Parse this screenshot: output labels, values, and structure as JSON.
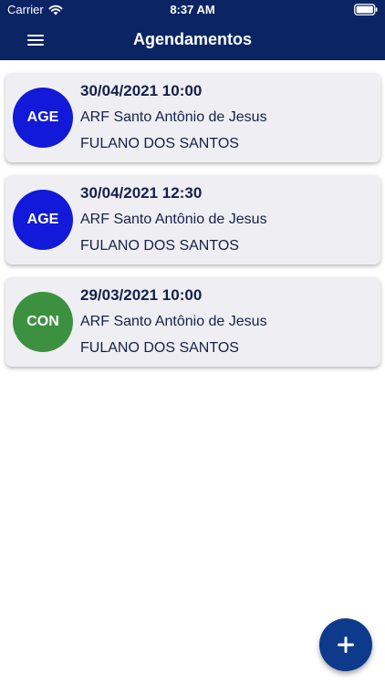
{
  "status_bar": {
    "carrier": "Carrier",
    "time": "8:37 AM"
  },
  "nav": {
    "title": "Agendamentos",
    "menu_icon": "hamburger-menu-icon"
  },
  "appointments": [
    {
      "status": "AGE",
      "status_color": "#1219d8",
      "datetime": "30/04/2021 10:00",
      "place": "ARF Santo Antônio de Jesus",
      "person": "FULANO DOS SANTOS"
    },
    {
      "status": "AGE",
      "status_color": "#1219d8",
      "datetime": "30/04/2021 12:30",
      "place": "ARF Santo Antônio de Jesus",
      "person": "FULANO DOS SANTOS"
    },
    {
      "status": "CON",
      "status_color": "#3c9141",
      "datetime": "29/03/2021 10:00",
      "place": "ARF Santo Antônio de Jesus",
      "person": "FULANO DOS SANTOS"
    }
  ],
  "fab": {
    "icon": "plus-icon"
  },
  "colors": {
    "header": "#0b2463",
    "card_background": "#efeff3",
    "text": "#15204a",
    "fab": "#0d3a8a"
  }
}
